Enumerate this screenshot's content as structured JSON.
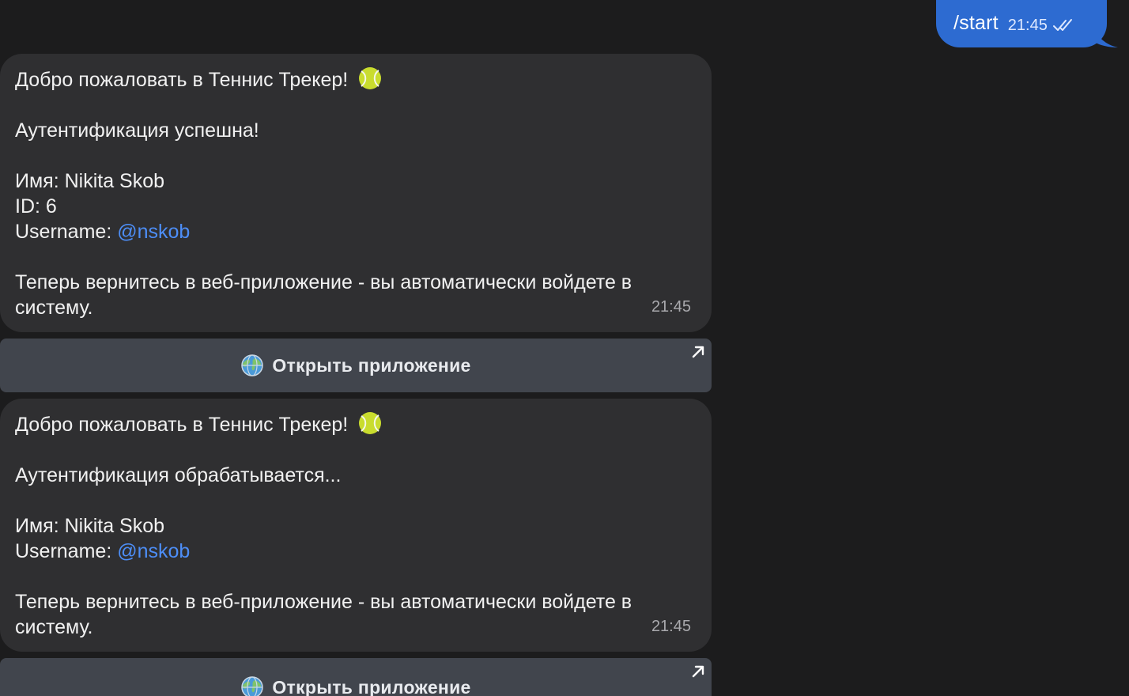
{
  "outgoing": {
    "text": "/start",
    "time": "21:45",
    "status_icon": "double-check-icon"
  },
  "messages": [
    {
      "title": "Добро пожаловать в Теннис Трекер!",
      "title_icon": "tennis-ball-icon",
      "status": "Аутентификация успешна!",
      "name": "Имя: Nikita Skob",
      "id": "ID: 6",
      "username_label": "Username: ",
      "username_link": "@nskob",
      "footer_line1": "Теперь вернитесь в веб-приложение - вы автоматически войдете в",
      "footer_line2": "систему.",
      "time": "21:45",
      "button": {
        "label": "Открыть приложение",
        "icon": "globe-icon",
        "corner_icon": "arrow-up-right-icon"
      }
    },
    {
      "title": "Добро пожаловать в Теннис Трекер!",
      "title_icon": "tennis-ball-icon",
      "status": "Аутентификация обрабатывается...",
      "name": "Имя: Nikita Skob",
      "username_label": "Username: ",
      "username_link": "@nskob",
      "footer_line1": "Теперь вернитесь в веб-приложение - вы автоматически войдете в",
      "footer_line2": "систему.",
      "time": "21:45",
      "button": {
        "label": "Открыть приложение",
        "icon": "globe-icon",
        "corner_icon": "arrow-up-right-icon"
      }
    }
  ],
  "colors": {
    "background": "#1c1c1d",
    "outgoing_bubble": "#2d6bd1",
    "incoming_bubble": "#2f2f31",
    "link": "#4d8ef7",
    "button": "#41454d"
  }
}
